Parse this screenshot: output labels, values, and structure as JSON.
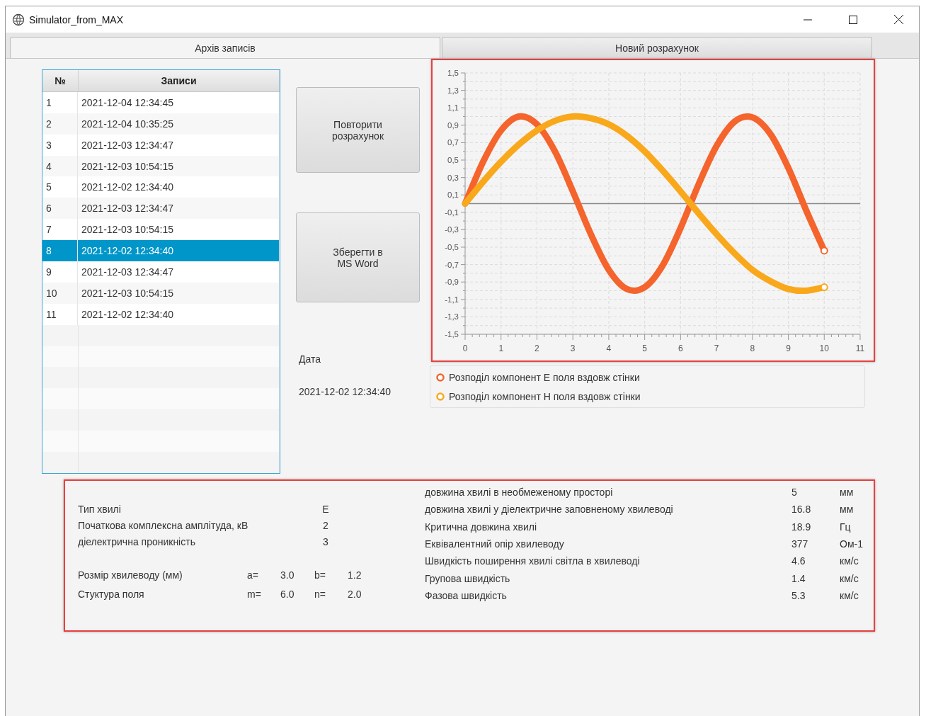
{
  "window": {
    "title": "Simulator_from_MAX"
  },
  "tabs": [
    {
      "label": "Архів записів",
      "selected": true
    },
    {
      "label": "Новий розрахунок",
      "selected": false
    }
  ],
  "table": {
    "columns": [
      "№",
      "Записи"
    ],
    "rows": [
      {
        "number": "1",
        "date": "2021-12-04 12:34:45",
        "selected": false
      },
      {
        "number": "2",
        "date": "2021-12-04 10:35:25",
        "selected": false
      },
      {
        "number": "3",
        "date": "2021-12-03 12:34:47",
        "selected": false
      },
      {
        "number": "4",
        "date": "2021-12-03 10:54:15",
        "selected": false
      },
      {
        "number": "5",
        "date": "2021-12-02 12:34:40",
        "selected": false
      },
      {
        "number": "6",
        "date": "2021-12-03 12:34:47",
        "selected": false
      },
      {
        "number": "7",
        "date": "2021-12-03 10:54:15",
        "selected": false
      },
      {
        "number": "8",
        "date": "2021-12-02 12:34:40",
        "selected": true
      },
      {
        "number": "9",
        "date": "2021-12-03 12:34:47",
        "selected": false
      },
      {
        "number": "10",
        "date": "2021-12-03 10:54:15",
        "selected": false
      },
      {
        "number": "11",
        "date": "2021-12-02 12:34:40",
        "selected": false
      }
    ]
  },
  "buttons": [
    "Повторити розрахунок",
    "Зберегти в MS Word"
  ],
  "date": {
    "label": "Дата",
    "value": "2021-12-02 12:34:40"
  },
  "chart": {
    "chart_data": {
      "type": "line",
      "x": [
        0,
        0.5,
        1,
        1.5,
        2,
        2.5,
        3,
        3.5,
        4,
        4.5,
        5,
        5.5,
        6,
        6.5,
        7,
        7.5,
        8,
        8.5,
        9,
        9.5,
        10
      ],
      "series": [
        {
          "name": "Розподіл компонент Е поля вздовж стінки",
          "color": "#f4642c",
          "values": [
            0,
            0.48,
            0.84,
            1.0,
            0.91,
            0.6,
            0.14,
            -0.35,
            -0.76,
            -0.98,
            -0.96,
            -0.71,
            -0.28,
            0.22,
            0.66,
            0.94,
            0.99,
            0.8,
            0.41,
            -0.08,
            -0.54
          ]
        },
        {
          "name": "Розподіл компонент Н поля вздовж стінки",
          "color": "#f9a81b",
          "values": [
            0,
            0.25,
            0.48,
            0.68,
            0.84,
            0.95,
            1.0,
            0.98,
            0.91,
            0.78,
            0.6,
            0.38,
            0.14,
            -0.11,
            -0.35,
            -0.57,
            -0.76,
            -0.89,
            -0.98,
            -1.0,
            -0.96
          ]
        }
      ],
      "grid": true,
      "xlim": [
        0,
        11
      ],
      "ylim": [
        -1.5,
        1.5
      ],
      "xticks": [
        0,
        1,
        2,
        3,
        4,
        5,
        6,
        7,
        8,
        9,
        10,
        11
      ],
      "yticks": [
        {
          "value": 1.5,
          "label": "1,5"
        },
        {
          "value": 1.3,
          "label": "1,3"
        },
        {
          "value": 1.1,
          "label": "1,1"
        },
        {
          "value": 0.9,
          "label": "0,9"
        },
        {
          "value": 0.7,
          "label": "0,7"
        },
        {
          "value": 0.5,
          "label": "0,5"
        },
        {
          "value": 0.3,
          "label": "0,3"
        },
        {
          "value": 0.1,
          "label": "0,1"
        },
        {
          "value": -0.1,
          "label": "-0,1"
        },
        {
          "value": -0.3,
          "label": "-0,3"
        },
        {
          "value": -0.5,
          "label": "-0,5"
        },
        {
          "value": -0.7,
          "label": "-0,7"
        },
        {
          "value": -0.9,
          "label": "-0,9"
        },
        {
          "value": -1.1,
          "label": "-1,1"
        },
        {
          "value": -1.3,
          "label": "-1,3"
        },
        {
          "value": -1.5,
          "label": "-1,5"
        }
      ]
    }
  },
  "wave_params": [
    {
      "label": "Тип хвилі",
      "value": "E"
    },
    {
      "label": "Початкова комплексна амплітуда,  кВ",
      "value": "2"
    },
    {
      "label": "діелектрична проникність",
      "value": "3"
    }
  ],
  "geometry": [
    {
      "label": "Розмір хвилеводу (мм)",
      "items": [
        {
          "label": "a=",
          "value": "3.0"
        },
        {
          "label": "b=",
          "value": "1.2"
        }
      ]
    },
    {
      "label": "Стуктура  поля",
      "items": [
        {
          "label": "m=",
          "value": "6.0"
        },
        {
          "label": "n=",
          "value": "2.0"
        }
      ]
    }
  ],
  "results": [
    {
      "label": "довжина хвилі в необмеженому просторі",
      "value": "5",
      "unit": "мм"
    },
    {
      "label": "довжина хвилі у діелектричне заповненому хвилеводі",
      "value": "16.8",
      "unit": "мм"
    },
    {
      "label": "Критична довжина хвилі",
      "value": "18.9",
      "unit": "Гц"
    },
    {
      "label": "Еквівалентний опір хвилеводу",
      "value": "377",
      "unit": "Ом-1"
    },
    {
      "label": "Швидкість  поширення хвилі світла в хвилеводі",
      "value": "4.6",
      "unit": "км/с"
    },
    {
      "label": "Групова швидкість",
      "value": "1.4",
      "unit": "км/с"
    },
    {
      "label": "Фазова швидкість",
      "value": "5.3",
      "unit": "км/с"
    }
  ]
}
